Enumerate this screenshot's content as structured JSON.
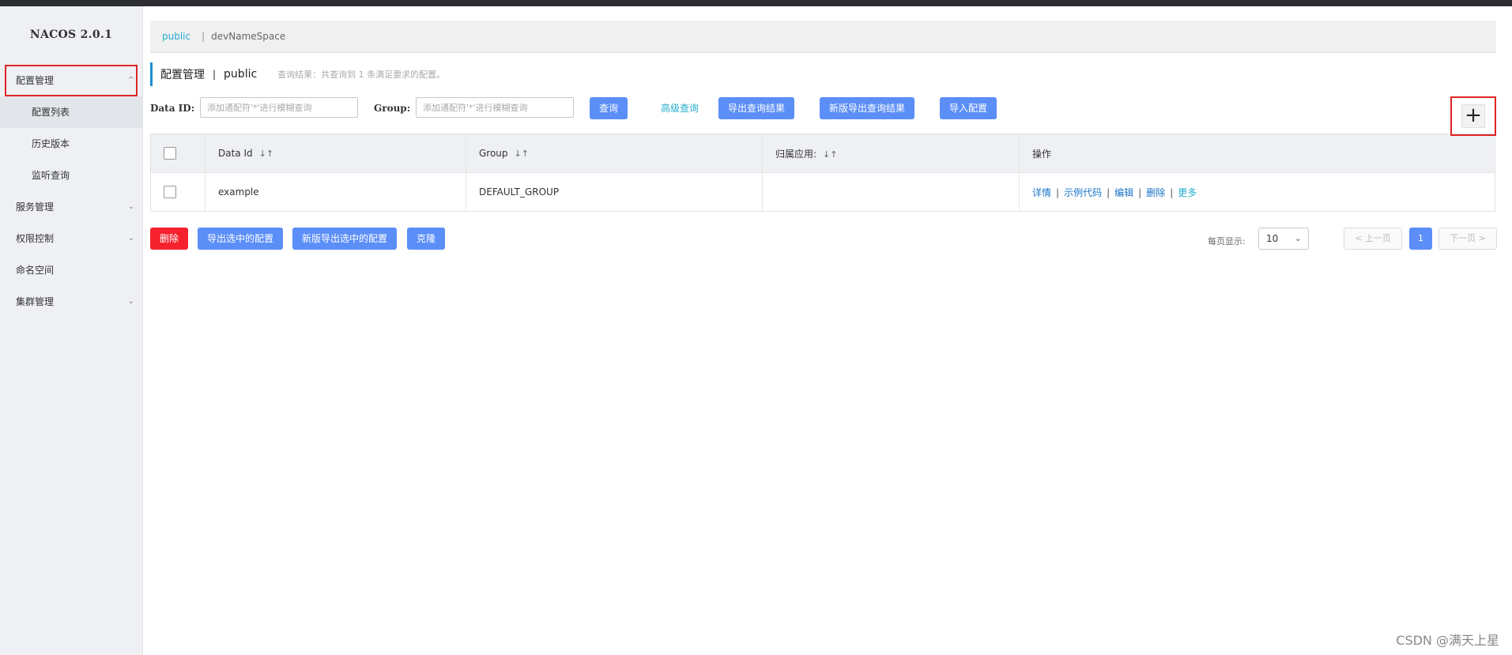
{
  "sidebar": {
    "brand": "NACOS 2.0.1",
    "items": [
      {
        "label": "配置管理",
        "chevron": "^"
      },
      {
        "label": "配置列表"
      },
      {
        "label": "历史版本"
      },
      {
        "label": "监听查询"
      },
      {
        "label": "服务管理",
        "chevron": "⌄"
      },
      {
        "label": "权限控制",
        "chevron": "⌄"
      },
      {
        "label": "命名空间"
      },
      {
        "label": "集群管理",
        "chevron": "⌄"
      }
    ]
  },
  "namespace_bar": {
    "active": "public",
    "separator": "|",
    "other": "devNameSpace"
  },
  "title": {
    "main": "配置管理",
    "separator": "|",
    "namespace": "public",
    "hint": "查询结果：共查询到 1 条满足要求的配置。"
  },
  "search": {
    "dataid_label": "Data ID:",
    "dataid_placeholder": "添加通配符'*'进行模糊查询",
    "group_label": "Group:",
    "group_placeholder": "添加通配符'*'进行模糊查询",
    "query_button": "查询",
    "advanced_query": "高级查询",
    "export_button": "导出查询结果",
    "new_export_button": "新版导出查询结果",
    "import_button": "导入配置",
    "add_button": "+"
  },
  "table": {
    "headers": [
      "Data Id",
      "Group",
      "归属应用:",
      "操作"
    ],
    "sort_icon": "↓↑",
    "rows": [
      {
        "data_id": "example",
        "group": "DEFAULT_GROUP",
        "app": "",
        "ops": [
          "详情",
          "示例代码",
          "编辑",
          "删除",
          "更多"
        ]
      }
    ],
    "op_separator": "|"
  },
  "bottom": {
    "delete_button": "删除",
    "export_selected": "导出选中的配置",
    "new_export_selected": "新版导出选中的配置",
    "clone_button": "克隆",
    "page_size_label": "每页显示:",
    "page_size": "10",
    "prev": "< 上一页",
    "page": "1",
    "next": "下一页 >"
  },
  "watermark": "CSDN @满天上星",
  "colors": {
    "primary": "#5b8ef7",
    "danger": "#f5222d",
    "link": "#1a73c8",
    "accent": "#24aecf",
    "highlight": "#e02424"
  }
}
